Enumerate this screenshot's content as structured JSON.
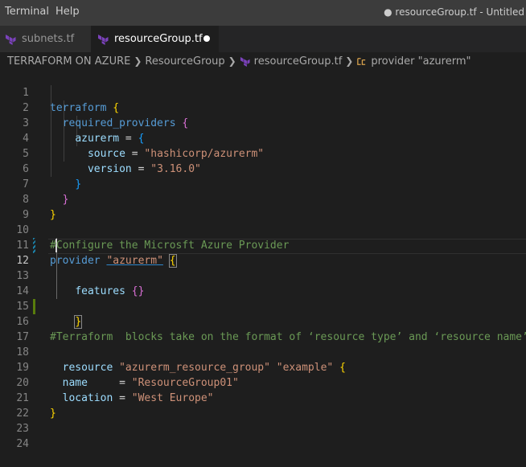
{
  "menubar": {
    "items": [
      "Terminal",
      "Help"
    ],
    "window_title": "● resourceGroup.tf - Untitled"
  },
  "tabs": [
    {
      "label": "subnets.tf",
      "active": false
    },
    {
      "label": "resourceGroup.tf",
      "active": true,
      "dirty": true
    }
  ],
  "breadcrumb": {
    "workspace": "TERRAFORM ON AZURE",
    "folder": "ResourceGroup",
    "file": "resourceGroup.tf",
    "symbol": "provider \"azurerm\""
  },
  "editor": {
    "current_line": 12,
    "lines": [
      {
        "n": "1"
      },
      {
        "n": "2"
      },
      {
        "n": "3"
      },
      {
        "n": "4"
      },
      {
        "n": "5"
      },
      {
        "n": "6"
      },
      {
        "n": "7"
      },
      {
        "n": "8"
      },
      {
        "n": "9"
      },
      {
        "n": "10"
      },
      {
        "n": "11"
      },
      {
        "n": "12"
      },
      {
        "n": "13"
      },
      {
        "n": "14"
      },
      {
        "n": "15"
      },
      {
        "n": "16"
      },
      {
        "n": "17"
      },
      {
        "n": "18"
      },
      {
        "n": "19"
      },
      {
        "n": "20"
      },
      {
        "n": "21"
      },
      {
        "n": "22"
      },
      {
        "n": "23"
      },
      {
        "n": "24"
      }
    ],
    "tokens": {
      "l1_kw": "terraform",
      "l1_brace": "{",
      "l2_kw": "required_providers",
      "l2_brace": "{",
      "l3_kw": "azurerm",
      "l3_eq": " = ",
      "l3_brace": "{",
      "l4_kw": "source",
      "l4_eq": " = ",
      "l4_str": "\"hashicorp/azurerm\"",
      "l5_kw": "version",
      "l5_eq": " = ",
      "l5_str": "\"3.16.0\"",
      "l6_brace": "}",
      "l7_brace": "}",
      "l8_brace": "}",
      "l10_comment": "#Configure the Microsft Azure Provider",
      "l11_kw": "provider",
      "l11_str": "\"azurerm\"",
      "l11_brace": "{",
      "l13_kw": "features",
      "l13_braces": "{}",
      "l15_brace": "}",
      "l16_comment": "#Terraform  blocks take on the format of ‘resource type’ and ‘resource name’",
      "l18_kw": "resource",
      "l18_str1": "\"azurerm_resource_group\"",
      "l18_str2": "\"example\"",
      "l18_brace": "{",
      "l19_kw": "name",
      "l19_eq": "     = ",
      "l19_str": "\"ResourceGroup01\"",
      "l20_kw": "location",
      "l20_eq": " = ",
      "l20_str": "\"West Europe\"",
      "l21_brace": "}"
    }
  },
  "colors": {
    "keyword": "#569cd6",
    "property": "#9cdcfe",
    "string": "#ce9178",
    "comment": "#6a9955",
    "accent_modified": "#587c0c"
  },
  "icons": {
    "tab_file": "terraform-icon",
    "breadcrumb_file": "terraform-icon",
    "breadcrumb_symbol": "symbol-namespace-icon"
  }
}
